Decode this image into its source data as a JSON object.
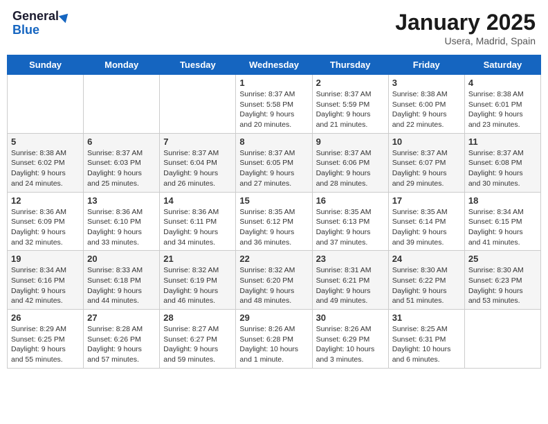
{
  "header": {
    "logo_general": "General",
    "logo_blue": "Blue",
    "month": "January 2025",
    "location": "Usera, Madrid, Spain"
  },
  "weekdays": [
    "Sunday",
    "Monday",
    "Tuesday",
    "Wednesday",
    "Thursday",
    "Friday",
    "Saturday"
  ],
  "weeks": [
    [
      {
        "day": "",
        "info": ""
      },
      {
        "day": "",
        "info": ""
      },
      {
        "day": "",
        "info": ""
      },
      {
        "day": "1",
        "info": "Sunrise: 8:37 AM\nSunset: 5:58 PM\nDaylight: 9 hours\nand 20 minutes."
      },
      {
        "day": "2",
        "info": "Sunrise: 8:37 AM\nSunset: 5:59 PM\nDaylight: 9 hours\nand 21 minutes."
      },
      {
        "day": "3",
        "info": "Sunrise: 8:38 AM\nSunset: 6:00 PM\nDaylight: 9 hours\nand 22 minutes."
      },
      {
        "day": "4",
        "info": "Sunrise: 8:38 AM\nSunset: 6:01 PM\nDaylight: 9 hours\nand 23 minutes."
      }
    ],
    [
      {
        "day": "5",
        "info": "Sunrise: 8:38 AM\nSunset: 6:02 PM\nDaylight: 9 hours\nand 24 minutes."
      },
      {
        "day": "6",
        "info": "Sunrise: 8:37 AM\nSunset: 6:03 PM\nDaylight: 9 hours\nand 25 minutes."
      },
      {
        "day": "7",
        "info": "Sunrise: 8:37 AM\nSunset: 6:04 PM\nDaylight: 9 hours\nand 26 minutes."
      },
      {
        "day": "8",
        "info": "Sunrise: 8:37 AM\nSunset: 6:05 PM\nDaylight: 9 hours\nand 27 minutes."
      },
      {
        "day": "9",
        "info": "Sunrise: 8:37 AM\nSunset: 6:06 PM\nDaylight: 9 hours\nand 28 minutes."
      },
      {
        "day": "10",
        "info": "Sunrise: 8:37 AM\nSunset: 6:07 PM\nDaylight: 9 hours\nand 29 minutes."
      },
      {
        "day": "11",
        "info": "Sunrise: 8:37 AM\nSunset: 6:08 PM\nDaylight: 9 hours\nand 30 minutes."
      }
    ],
    [
      {
        "day": "12",
        "info": "Sunrise: 8:36 AM\nSunset: 6:09 PM\nDaylight: 9 hours\nand 32 minutes."
      },
      {
        "day": "13",
        "info": "Sunrise: 8:36 AM\nSunset: 6:10 PM\nDaylight: 9 hours\nand 33 minutes."
      },
      {
        "day": "14",
        "info": "Sunrise: 8:36 AM\nSunset: 6:11 PM\nDaylight: 9 hours\nand 34 minutes."
      },
      {
        "day": "15",
        "info": "Sunrise: 8:35 AM\nSunset: 6:12 PM\nDaylight: 9 hours\nand 36 minutes."
      },
      {
        "day": "16",
        "info": "Sunrise: 8:35 AM\nSunset: 6:13 PM\nDaylight: 9 hours\nand 37 minutes."
      },
      {
        "day": "17",
        "info": "Sunrise: 8:35 AM\nSunset: 6:14 PM\nDaylight: 9 hours\nand 39 minutes."
      },
      {
        "day": "18",
        "info": "Sunrise: 8:34 AM\nSunset: 6:15 PM\nDaylight: 9 hours\nand 41 minutes."
      }
    ],
    [
      {
        "day": "19",
        "info": "Sunrise: 8:34 AM\nSunset: 6:16 PM\nDaylight: 9 hours\nand 42 minutes."
      },
      {
        "day": "20",
        "info": "Sunrise: 8:33 AM\nSunset: 6:18 PM\nDaylight: 9 hours\nand 44 minutes."
      },
      {
        "day": "21",
        "info": "Sunrise: 8:32 AM\nSunset: 6:19 PM\nDaylight: 9 hours\nand 46 minutes."
      },
      {
        "day": "22",
        "info": "Sunrise: 8:32 AM\nSunset: 6:20 PM\nDaylight: 9 hours\nand 48 minutes."
      },
      {
        "day": "23",
        "info": "Sunrise: 8:31 AM\nSunset: 6:21 PM\nDaylight: 9 hours\nand 49 minutes."
      },
      {
        "day": "24",
        "info": "Sunrise: 8:30 AM\nSunset: 6:22 PM\nDaylight: 9 hours\nand 51 minutes."
      },
      {
        "day": "25",
        "info": "Sunrise: 8:30 AM\nSunset: 6:23 PM\nDaylight: 9 hours\nand 53 minutes."
      }
    ],
    [
      {
        "day": "26",
        "info": "Sunrise: 8:29 AM\nSunset: 6:25 PM\nDaylight: 9 hours\nand 55 minutes."
      },
      {
        "day": "27",
        "info": "Sunrise: 8:28 AM\nSunset: 6:26 PM\nDaylight: 9 hours\nand 57 minutes."
      },
      {
        "day": "28",
        "info": "Sunrise: 8:27 AM\nSunset: 6:27 PM\nDaylight: 9 hours\nand 59 minutes."
      },
      {
        "day": "29",
        "info": "Sunrise: 8:26 AM\nSunset: 6:28 PM\nDaylight: 10 hours\nand 1 minute."
      },
      {
        "day": "30",
        "info": "Sunrise: 8:26 AM\nSunset: 6:29 PM\nDaylight: 10 hours\nand 3 minutes."
      },
      {
        "day": "31",
        "info": "Sunrise: 8:25 AM\nSunset: 6:31 PM\nDaylight: 10 hours\nand 6 minutes."
      },
      {
        "day": "",
        "info": ""
      }
    ]
  ]
}
